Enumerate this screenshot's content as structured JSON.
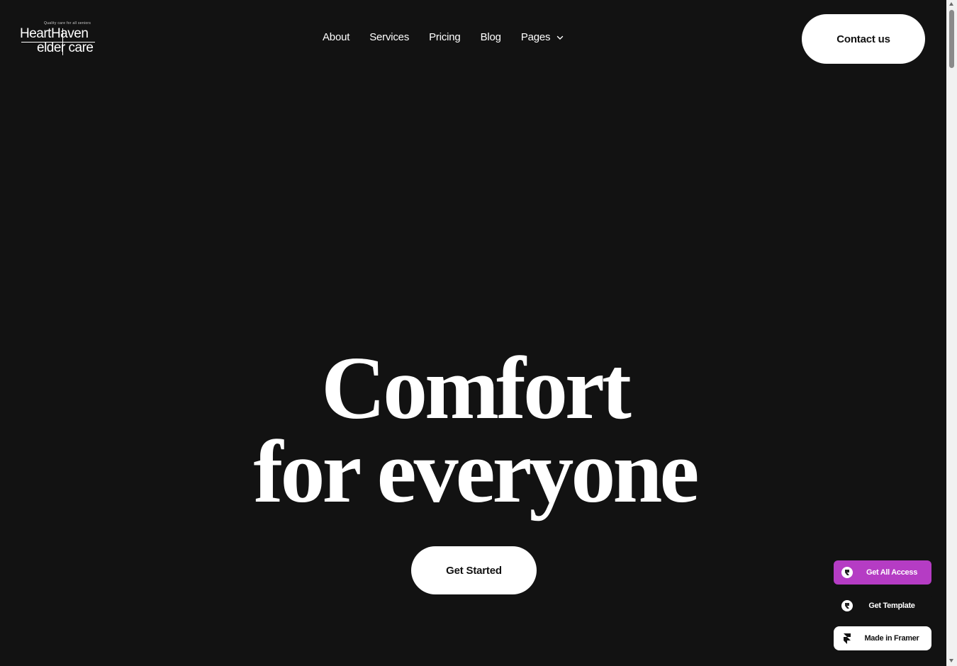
{
  "logo": {
    "tagline": "Quality care for all seniors",
    "line1": "HeartHaven",
    "line2": "elder care"
  },
  "nav": {
    "items": [
      {
        "label": "About"
      },
      {
        "label": "Services"
      },
      {
        "label": "Pricing"
      },
      {
        "label": "Blog"
      },
      {
        "label": "Pages"
      }
    ]
  },
  "header": {
    "contact_label": "Contact us"
  },
  "hero": {
    "title_line1": "Comfort",
    "title_line2": "for everyone",
    "cta_label": "Get Started"
  },
  "widgets": {
    "all_access_label": "Get All Access",
    "template_label": "Get Template",
    "framer_label": "Made in Framer"
  },
  "colors": {
    "background": "#121212",
    "accent": "#b53cc4",
    "button_bg": "#ffffff"
  }
}
